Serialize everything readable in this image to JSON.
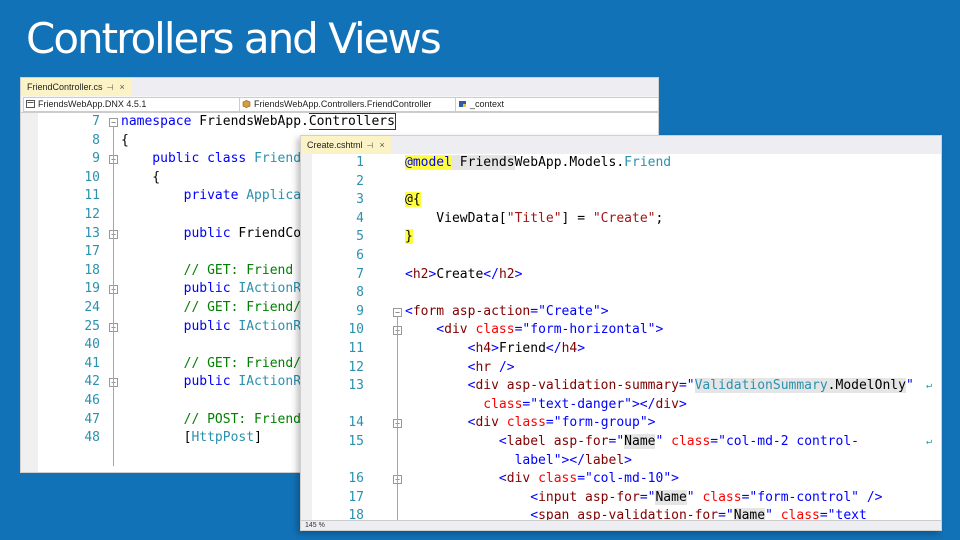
{
  "slide": {
    "title": "Controllers and Views"
  },
  "back_editor": {
    "tab": {
      "label": "FriendController.cs",
      "pin": "⊣",
      "close": "×"
    },
    "nav": {
      "project": "FriendsWebApp.DNX 4.5.1",
      "class": "FriendsWebApp.Controllers.FriendController",
      "member": "_context"
    },
    "lines": [
      {
        "num": "7",
        "fold": "−",
        "tokens": [
          {
            "t": "namespace ",
            "c": "k"
          },
          {
            "t": "FriendsWebApp.",
            "c": "p"
          },
          {
            "t": "Controllers",
            "c": "p caret"
          }
        ]
      },
      {
        "num": "8",
        "tokens": [
          {
            "t": "{",
            "c": "p"
          }
        ]
      },
      {
        "num": "9",
        "fold": "−",
        "tokens": [
          {
            "t": "    public ",
            "c": "k"
          },
          {
            "t": "class ",
            "c": "k"
          },
          {
            "t": "Friend",
            "c": "t"
          }
        ]
      },
      {
        "num": "10",
        "tokens": [
          {
            "t": "    {",
            "c": "p"
          }
        ]
      },
      {
        "num": "11",
        "tokens": [
          {
            "t": "        private ",
            "c": "k"
          },
          {
            "t": "Applica",
            "c": "t"
          }
        ]
      },
      {
        "num": "12",
        "tokens": []
      },
      {
        "num": "13",
        "fold": "+",
        "tokens": [
          {
            "t": "        public ",
            "c": "k"
          },
          {
            "t": "FriendCo",
            "c": "p"
          }
        ]
      },
      {
        "num": "17",
        "tokens": []
      },
      {
        "num": "18",
        "tokens": [
          {
            "t": "        // GET: Friend",
            "c": "c"
          }
        ]
      },
      {
        "num": "19",
        "fold": "+",
        "tokens": [
          {
            "t": "        public ",
            "c": "k"
          },
          {
            "t": "IActionR",
            "c": "t"
          }
        ]
      },
      {
        "num": "24",
        "tokens": [
          {
            "t": "        // GET: Friend/",
            "c": "c"
          }
        ]
      },
      {
        "num": "25",
        "fold": "+",
        "tokens": [
          {
            "t": "        public ",
            "c": "k"
          },
          {
            "t": "IActionR",
            "c": "t"
          }
        ]
      },
      {
        "num": "40",
        "tokens": []
      },
      {
        "num": "41",
        "tokens": [
          {
            "t": "        // GET: Friend/",
            "c": "c"
          }
        ]
      },
      {
        "num": "42",
        "fold": "+",
        "tokens": [
          {
            "t": "        public ",
            "c": "k"
          },
          {
            "t": "IActionR",
            "c": "t"
          }
        ]
      },
      {
        "num": "46",
        "tokens": []
      },
      {
        "num": "47",
        "tokens": [
          {
            "t": "        // POST: Friend",
            "c": "c"
          }
        ]
      },
      {
        "num": "48",
        "tokens": [
          {
            "t": "        [",
            "c": "p"
          },
          {
            "t": "HttpPost",
            "c": "t"
          },
          {
            "t": "]",
            "c": "p"
          }
        ]
      }
    ]
  },
  "front_editor": {
    "tab": {
      "label": "Create.cshtml",
      "pin": "⊣",
      "close": "×"
    },
    "lines": [
      {
        "num": "1",
        "tokens": [
          {
            "t": "@model",
            "c": "k y"
          },
          {
            "t": " Friends",
            "c": "p hl"
          },
          {
            "t": "WebApp.Models.",
            "c": "p"
          },
          {
            "t": "Friend",
            "c": "t"
          }
        ]
      },
      {
        "num": "2",
        "tokens": []
      },
      {
        "num": "3",
        "tokens": [
          {
            "t": "@{",
            "c": "p y"
          }
        ]
      },
      {
        "num": "4",
        "tokens": [
          {
            "t": "    ViewData[",
            "c": "p"
          },
          {
            "t": "\"Title\"",
            "c": "s"
          },
          {
            "t": "] = ",
            "c": "p"
          },
          {
            "t": "\"Create\"",
            "c": "s"
          },
          {
            "t": ";",
            "c": "p"
          }
        ]
      },
      {
        "num": "5",
        "tokens": [
          {
            "t": "}",
            "c": "p y"
          }
        ]
      },
      {
        "num": "6",
        "tokens": []
      },
      {
        "num": "7",
        "tokens": [
          {
            "t": "<",
            "c": "v"
          },
          {
            "t": "h2",
            "c": "tg"
          },
          {
            "t": ">",
            "c": "v"
          },
          {
            "t": "Create",
            "c": "p"
          },
          {
            "t": "</",
            "c": "v"
          },
          {
            "t": "h2",
            "c": "tg"
          },
          {
            "t": ">",
            "c": "v"
          }
        ]
      },
      {
        "num": "8",
        "tokens": []
      },
      {
        "num": "9",
        "fold": "−",
        "tokens": [
          {
            "t": "<",
            "c": "v"
          },
          {
            "t": "form ",
            "c": "tg"
          },
          {
            "t": "asp-action",
            "c": "tg"
          },
          {
            "t": "=\"",
            "c": "v"
          },
          {
            "t": "Create",
            "c": "v"
          },
          {
            "t": "\">",
            "c": "v"
          }
        ]
      },
      {
        "num": "10",
        "fold": "−",
        "tokens": [
          {
            "t": "    <",
            "c": "v"
          },
          {
            "t": "div ",
            "c": "tg"
          },
          {
            "t": "class",
            "c": "a"
          },
          {
            "t": "=\"",
            "c": "v"
          },
          {
            "t": "form-horizontal",
            "c": "v"
          },
          {
            "t": "\">",
            "c": "v"
          }
        ]
      },
      {
        "num": "11",
        "tokens": [
          {
            "t": "        <",
            "c": "v"
          },
          {
            "t": "h4",
            "c": "tg"
          },
          {
            "t": ">",
            "c": "v"
          },
          {
            "t": "Friend",
            "c": "p"
          },
          {
            "t": "</",
            "c": "v"
          },
          {
            "t": "h4",
            "c": "tg"
          },
          {
            "t": ">",
            "c": "v"
          }
        ]
      },
      {
        "num": "12",
        "tokens": [
          {
            "t": "        <",
            "c": "v"
          },
          {
            "t": "hr ",
            "c": "tg"
          },
          {
            "t": "/>",
            "c": "v"
          }
        ]
      },
      {
        "num": "13",
        "wrap": true,
        "tokens": [
          {
            "t": "        <",
            "c": "v"
          },
          {
            "t": "div ",
            "c": "tg"
          },
          {
            "t": "asp-validation-summary",
            "c": "tg"
          },
          {
            "t": "=\"",
            "c": "v"
          },
          {
            "t": "ValidationSummary",
            "c": "t hl"
          },
          {
            "t": ".ModelOnly",
            "c": "p hl"
          },
          {
            "t": "\"",
            "c": "v"
          }
        ]
      },
      {
        "num": "",
        "tokens": [
          {
            "t": "          class",
            "c": "a"
          },
          {
            "t": "=\"",
            "c": "v"
          },
          {
            "t": "text-danger",
            "c": "v"
          },
          {
            "t": "\"></",
            "c": "v"
          },
          {
            "t": "div",
            "c": "tg"
          },
          {
            "t": ">",
            "c": "v"
          }
        ]
      },
      {
        "num": "14",
        "fold": "−",
        "tokens": [
          {
            "t": "        <",
            "c": "v"
          },
          {
            "t": "div ",
            "c": "tg"
          },
          {
            "t": "class",
            "c": "a"
          },
          {
            "t": "=\"",
            "c": "v"
          },
          {
            "t": "form-group",
            "c": "v"
          },
          {
            "t": "\">",
            "c": "v"
          }
        ]
      },
      {
        "num": "15",
        "wrap": true,
        "tokens": [
          {
            "t": "            <",
            "c": "v"
          },
          {
            "t": "label ",
            "c": "tg"
          },
          {
            "t": "asp-for",
            "c": "tg"
          },
          {
            "t": "=\"",
            "c": "v"
          },
          {
            "t": "Name",
            "c": "p hl"
          },
          {
            "t": "\" ",
            "c": "v"
          },
          {
            "t": "class",
            "c": "a"
          },
          {
            "t": "=\"",
            "c": "v"
          },
          {
            "t": "col-md-2 control-",
            "c": "v"
          }
        ]
      },
      {
        "num": "",
        "tokens": [
          {
            "t": "              label",
            "c": "v"
          },
          {
            "t": "\"></",
            "c": "v"
          },
          {
            "t": "label",
            "c": "tg"
          },
          {
            "t": ">",
            "c": "v"
          }
        ]
      },
      {
        "num": "16",
        "fold": "−",
        "tokens": [
          {
            "t": "            <",
            "c": "v"
          },
          {
            "t": "div ",
            "c": "tg"
          },
          {
            "t": "class",
            "c": "a"
          },
          {
            "t": "=\"",
            "c": "v"
          },
          {
            "t": "col-md-10",
            "c": "v"
          },
          {
            "t": "\">",
            "c": "v"
          }
        ]
      },
      {
        "num": "17",
        "tokens": [
          {
            "t": "                <",
            "c": "v"
          },
          {
            "t": "input ",
            "c": "tg"
          },
          {
            "t": "asp-for",
            "c": "tg"
          },
          {
            "t": "=\"",
            "c": "v"
          },
          {
            "t": "Name",
            "c": "p hl"
          },
          {
            "t": "\" ",
            "c": "v"
          },
          {
            "t": "class",
            "c": "a"
          },
          {
            "t": "=\"",
            "c": "v"
          },
          {
            "t": "form-control",
            "c": "v"
          },
          {
            "t": "\" />",
            "c": "v"
          }
        ]
      },
      {
        "num": "18",
        "tokens": [
          {
            "t": "                <",
            "c": "v"
          },
          {
            "t": "span ",
            "c": "tg"
          },
          {
            "t": "asp-validation-for",
            "c": "tg"
          },
          {
            "t": "=\"",
            "c": "v"
          },
          {
            "t": "Name",
            "c": "p hl"
          },
          {
            "t": "\" ",
            "c": "v"
          },
          {
            "t": "class",
            "c": "a"
          },
          {
            "t": "=\"",
            "c": "v"
          },
          {
            "t": "text",
            "c": "v"
          }
        ]
      }
    ],
    "status": "145 %"
  },
  "colors": {
    "slide_bg": "#1272b8",
    "keyword": "#0000ff",
    "comment": "#008000",
    "type": "#2b91af",
    "string": "#a31515",
    "tag": "#800000",
    "attr": "#ff0000"
  }
}
